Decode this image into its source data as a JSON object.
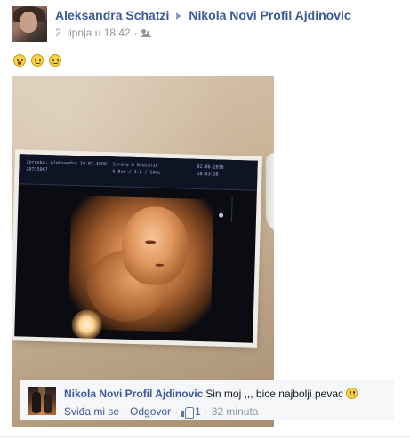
{
  "post": {
    "author": "Aleksandra Schatzi",
    "target": "Nikola Novi Profil Ajdinovic",
    "timestamp": "2. lipnja u 18:42",
    "audience_icon": "friends-icon",
    "emoticons": [
      "wow-emoticon",
      "smile-emoticon",
      "smile-emoticon"
    ]
  },
  "photo": {
    "scan_header": {
      "left_1": "Zoraska, Aleksandra 10.07.1990",
      "left_2": "20735067",
      "mid_1": "Sirala & Ordzalić",
      "mid_2": "6.8cm / 1.8 / 50Hz",
      "right_1": "02.06.2016",
      "right_2": "18:03:10"
    }
  },
  "comment": {
    "author": "Nikola Novi Profil Ajdinovic",
    "text": "Sin moj ,,, bice najbolji pevac",
    "like_label": "Sviđa mi se",
    "reply_label": "Odgovor",
    "like_count": "1",
    "time": "32 minuta",
    "separator": "·"
  },
  "colors": {
    "link": "#3b5998",
    "meta": "#9197a3",
    "comment_bg": "#f6f7f9"
  }
}
